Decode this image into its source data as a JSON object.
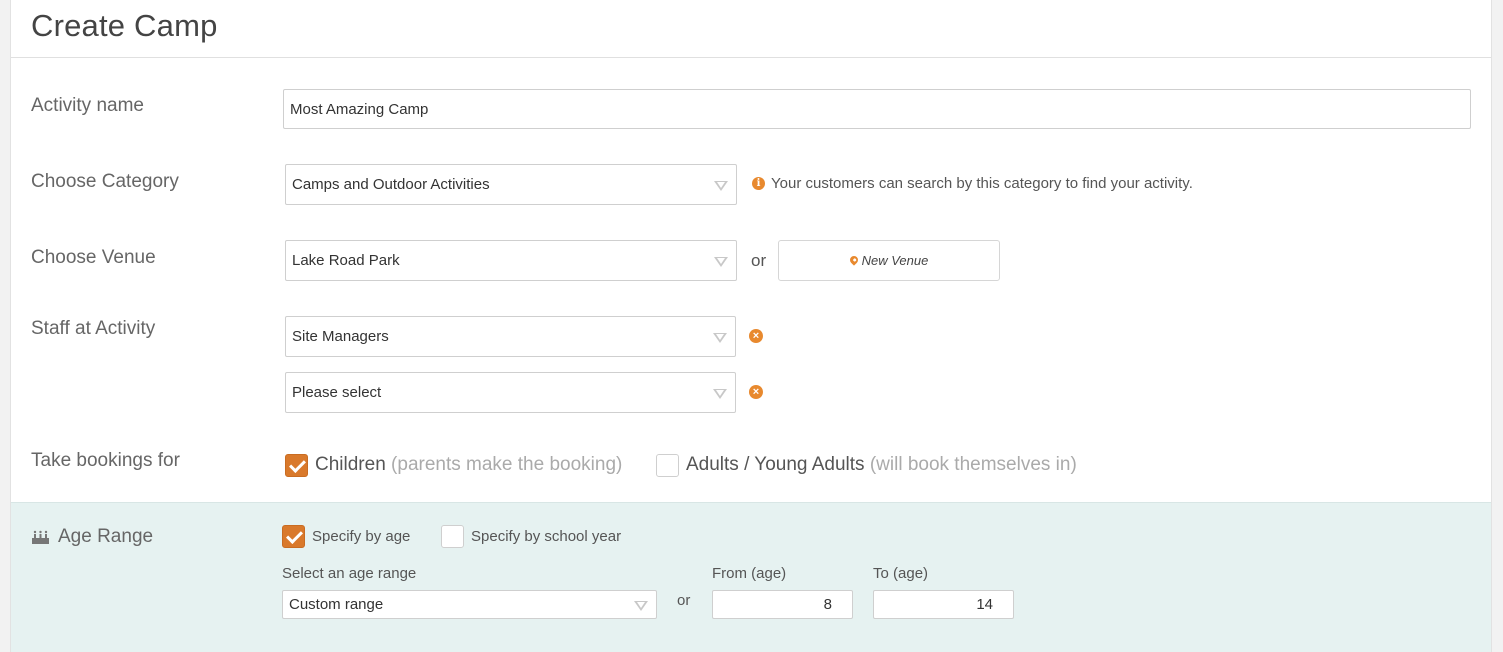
{
  "header": {
    "title": "Create Camp"
  },
  "form": {
    "activity_name": {
      "label": "Activity name",
      "value": "Most Amazing Camp"
    },
    "category": {
      "label": "Choose Category",
      "selected": "Camps and Outdoor Activities",
      "hint": "Your customers can search by this category to find your activity.",
      "hint_icon": "info-icon"
    },
    "venue": {
      "label": "Choose Venue",
      "selected": "Lake Road Park",
      "or": "or",
      "new_venue_label": "New Venue",
      "new_venue_icon": "map-pin-icon"
    },
    "staff": {
      "label": "Staff at Activity",
      "selects": [
        "Site Managers",
        "Please select"
      ],
      "remove_icon": "remove-circle-icon"
    },
    "bookings": {
      "label": "Take bookings for",
      "children": {
        "label": "Children",
        "note": "(parents make the booking)",
        "checked": true
      },
      "adults": {
        "label": "Adults / Young Adults",
        "note": "(will book themselves in)",
        "checked": false
      }
    },
    "age_range": {
      "label": "Age Range",
      "icon": "birthday-cake-icon",
      "specify_by_age": {
        "label": "Specify by age",
        "checked": true
      },
      "specify_by_school_year": {
        "label": "Specify by school year",
        "checked": false
      },
      "select_label": "Select an age range",
      "select_value": "Custom range",
      "or": "or",
      "from_label": "From (age)",
      "from_value": "8",
      "to_label": "To (age)",
      "to_value": "14"
    }
  },
  "colors": {
    "accent": "#d9792b",
    "section_bg": "#e6f2f1"
  }
}
